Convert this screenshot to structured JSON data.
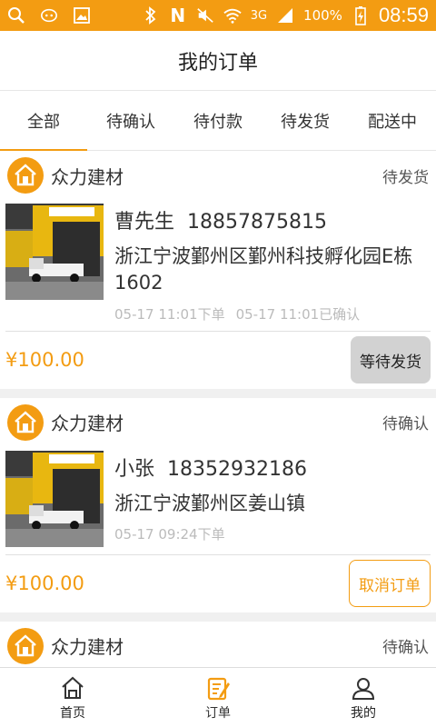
{
  "status_bar": {
    "battery": "100%",
    "network": "3G",
    "time": "08:59"
  },
  "header": {
    "title": "我的订单"
  },
  "tabs": [
    {
      "label": "全部",
      "active": true
    },
    {
      "label": "待确认",
      "active": false
    },
    {
      "label": "待付款",
      "active": false
    },
    {
      "label": "待发货",
      "active": false
    },
    {
      "label": "配送中",
      "active": false
    }
  ],
  "orders": [
    {
      "store": "众力建材",
      "status": "待发货",
      "name": "曹先生",
      "phone": "18857875815",
      "address": "浙江宁波鄞州区鄞州科技孵化园E栋1602",
      "order_time": "05-17 11:01下单",
      "confirm_time": "05-17 11:01已确认",
      "price": "¥100.00",
      "action": "等待发货",
      "action_style": "gray"
    },
    {
      "store": "众力建材",
      "status": "待确认",
      "name": "小张",
      "phone": "18352932186",
      "address": "浙江宁波鄞州区姜山镇",
      "order_time": "05-17 09:24下单",
      "confirm_time": "",
      "price": "¥100.00",
      "action": "取消订单",
      "action_style": "outline"
    },
    {
      "store": "众力建材",
      "status": "待确认"
    }
  ],
  "bottom_nav": [
    {
      "label": "首页",
      "icon": "home-icon"
    },
    {
      "label": "订单",
      "icon": "orders-icon",
      "active": true
    },
    {
      "label": "我的",
      "icon": "profile-icon"
    }
  ],
  "colors": {
    "accent": "#f39c12"
  }
}
